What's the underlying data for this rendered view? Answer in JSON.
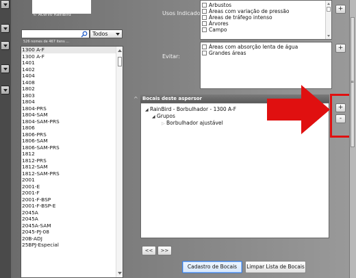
{
  "image_caption": "© Acervo RainBird",
  "list_count": "526 nomes de 467 itens ...",
  "filter": {
    "selected": "Todos"
  },
  "nozzle_list": [
    "1300 A-F",
    "1300 A-F",
    "1401",
    "1402",
    "1404",
    "1408",
    "1802",
    "1803",
    "1804",
    "1804-PRS",
    "1804-SAM",
    "1804-SAM-PRS",
    "1806",
    "1806-PRS",
    "1806-SAM",
    "1806-SAM-PRS",
    "1812",
    "1812-PRS",
    "1812-SAM",
    "1812-SAM-PRS",
    "2001",
    "2001-E",
    "2001-F",
    "2001-F-BSP",
    "2001-F-BSP-E",
    "2045A",
    "2045A",
    "2045A-SAM",
    "2045-PJ-08",
    "20B-ADJ",
    "25BPJ-Especial"
  ],
  "usos": {
    "label": "Usos Indicados:",
    "items": [
      "Arbustos",
      "Áreas com variação de pressão",
      "Áreas de tráfego intenso",
      "Árvores",
      "Campo"
    ],
    "add_label": "+"
  },
  "evitar": {
    "label": "Evitar:",
    "items": [
      "Áreas com absorção lenta de água",
      "Grandes áreas"
    ],
    "add_label": "+"
  },
  "bocais": {
    "title": "Bocais deste aspersor",
    "expander": "^",
    "tree": {
      "root": "RainBird - Borbulhador - 1300 A-F",
      "child": "Grupos",
      "leaf": "Borbulhador ajustável"
    },
    "add_label": "+",
    "remove_label": "-"
  },
  "nav": {
    "prev": "<<",
    "next": ">>"
  },
  "buttons": {
    "cadastro": "Cadastro de Bocais",
    "limpar": "Limpar Lista de Bocais"
  },
  "colors": {
    "highlight": "#e01010"
  }
}
